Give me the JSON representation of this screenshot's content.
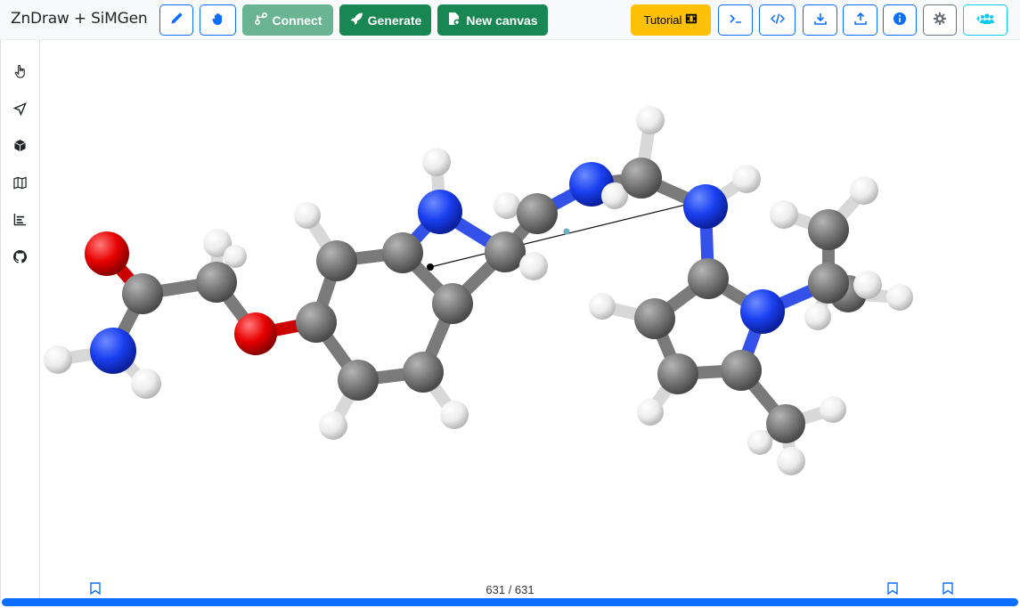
{
  "app": {
    "title": "ZnDraw + SiMGen"
  },
  "toolbar": {
    "edit_icon": "pencil-icon",
    "interact_icon": "hand-icon",
    "connect_label": "Connect",
    "generate_label": "Generate",
    "new_canvas_label": "New canvas",
    "tutorial_label": "Tutorial",
    "right_icons": [
      "terminal-icon",
      "code-icon",
      "download-icon",
      "upload-icon",
      "info-icon",
      "gear-icon",
      "users-icon"
    ]
  },
  "sidebar": {
    "items": [
      "selection-icon",
      "geometry-icon",
      "modifier-icon",
      "scene-icon",
      "analysis-icon",
      "github-icon"
    ]
  },
  "timeline": {
    "frame_display": "631 / 631",
    "progress": 1.0,
    "bookmark_count": 3
  },
  "colors": {
    "carbon": "#7a7a7a",
    "nitrogen": "#1a3ff0",
    "oxygen": "#e80000",
    "hydrogen": "#f2f2f2",
    "primary": "#0d6efd",
    "success": "#198754",
    "warning": "#ffc107"
  }
}
